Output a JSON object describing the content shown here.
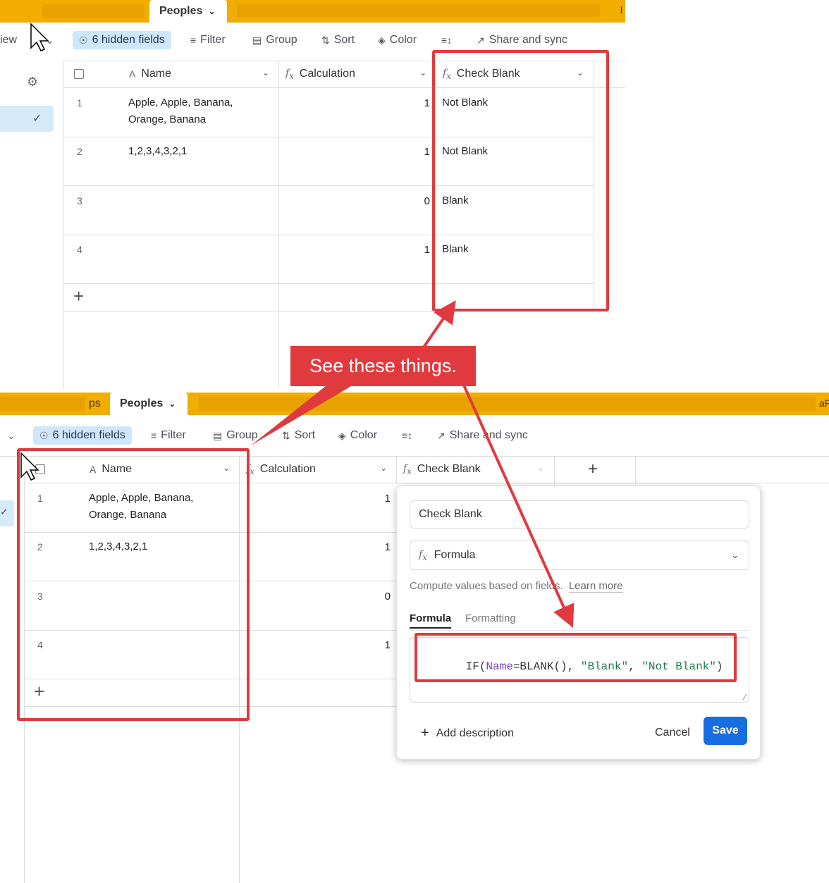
{
  "top": {
    "active_tab": "Peoples",
    "tab_fragment_left": "iew",
    "tab_fragment_right": "l",
    "toolbar": {
      "hidden_fields": "6 hidden fields",
      "filter": "Filter",
      "group": "Group",
      "sort": "Sort",
      "color": "Color",
      "share": "Share and sync"
    },
    "columns": {
      "name": "Name",
      "calculation": "Calculation",
      "check": "Check Blank"
    },
    "rows": [
      {
        "num": "1",
        "name_line1": "Apple, Apple, Banana,",
        "name_line2": "Orange, Banana",
        "calc": "1",
        "check": "Not Blank"
      },
      {
        "num": "2",
        "name_line1": "1,2,3,4,3,2,1",
        "name_line2": "",
        "calc": "1",
        "check": "Not Blank"
      },
      {
        "num": "3",
        "name_line1": "",
        "name_line2": "",
        "calc": "0",
        "check": "Blank"
      },
      {
        "num": "4",
        "name_line1": "",
        "name_line2": "",
        "calc": "1",
        "check": "Blank"
      }
    ],
    "add_row": "+"
  },
  "bottom": {
    "tab_fragment_left": "ps",
    "tab_fragment_right": "aF",
    "active_tab": "Peoples",
    "toolbar": {
      "hidden_fields": "6 hidden fields",
      "filter": "Filter",
      "group": "Group",
      "sort": "Sort",
      "color": "Color",
      "share": "Share and sync"
    },
    "columns": {
      "name": "Name",
      "calculation": "Calculation",
      "check": "Check Blank",
      "add": "+"
    },
    "rows": [
      {
        "num": "1",
        "name_line1": "Apple, Apple, Banana,",
        "name_line2": "Orange, Banana",
        "calc": "1"
      },
      {
        "num": "2",
        "name_line1": "1,2,3,4,3,2,1",
        "name_line2": "",
        "calc": "1"
      },
      {
        "num": "3",
        "name_line1": "",
        "name_line2": "",
        "calc": "0"
      },
      {
        "num": "4",
        "name_line1": "",
        "name_line2": "",
        "calc": "1"
      }
    ],
    "add_row": "+"
  },
  "popup": {
    "field_name": "Check Blank",
    "field_type": "Formula",
    "description": "Compute values based on fields.",
    "learn_more": "Learn more",
    "tab_formula": "Formula",
    "tab_formatting": "Formatting",
    "formula": {
      "fn_if": "IF(",
      "name": "Name",
      "mid": "=BLANK(), ",
      "str_blank": "\"Blank\"",
      "comma": ", ",
      "str_not_blank": "\"Not Blank\"",
      "close": ")"
    },
    "add_description": "Add description",
    "cancel": "Cancel",
    "save": "Save"
  },
  "callout": "See these things.",
  "colors": {
    "accent_red": "#e03a3e",
    "tab_bar": "#f1ad00",
    "save_blue": "#166ee1",
    "hidden_fields_bg": "#cfe6fb"
  }
}
